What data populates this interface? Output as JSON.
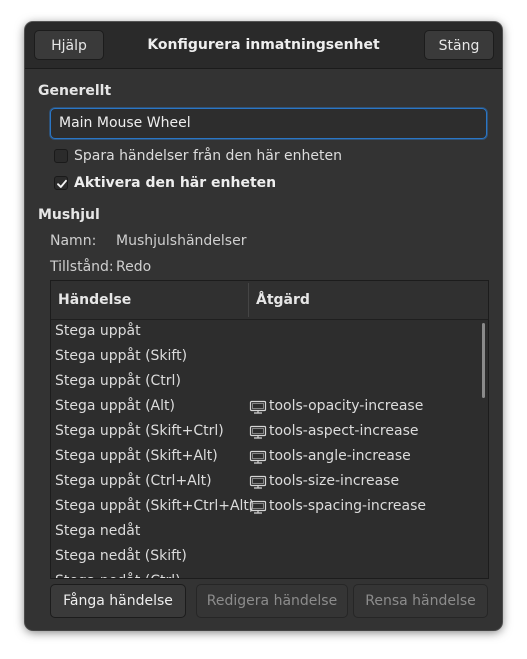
{
  "header": {
    "help_label": "Hjälp",
    "title": "Konfigurera inmatningsenhet",
    "close_label": "Stäng"
  },
  "general": {
    "section_title": "Generellt",
    "device_name": "Main Mouse Wheel",
    "save_events_label": "Spara händelser från den här enheten",
    "save_events_checked": false,
    "enable_device_label": "Aktivera den här enheten",
    "enable_device_checked": true
  },
  "mouse_wheel": {
    "section_title": "Mushjul",
    "name_label": "Namn:",
    "name_value": "Mushjulshändelser",
    "state_label": "Tillstånd:",
    "state_value": "Redo"
  },
  "table": {
    "columns": [
      "Händelse",
      "Åtgärd"
    ],
    "rows": [
      {
        "event": "Stega uppåt",
        "action": ""
      },
      {
        "event": "Stega uppåt (Skift)",
        "action": ""
      },
      {
        "event": "Stega uppåt (Ctrl)",
        "action": ""
      },
      {
        "event": "Stega uppåt (Alt)",
        "action": "tools-opacity-increase"
      },
      {
        "event": "Stega uppåt (Skift+Ctrl)",
        "action": "tools-aspect-increase"
      },
      {
        "event": "Stega uppåt (Skift+Alt)",
        "action": "tools-angle-increase"
      },
      {
        "event": "Stega uppåt (Ctrl+Alt)",
        "action": "tools-size-increase"
      },
      {
        "event": "Stega uppåt (Skift+Ctrl+Alt)",
        "action": "tools-spacing-increase"
      },
      {
        "event": "Stega nedåt",
        "action": ""
      },
      {
        "event": "Stega nedåt (Skift)",
        "action": ""
      },
      {
        "event": "Stega nedåt (Ctrl)",
        "action": ""
      }
    ]
  },
  "footer": {
    "grab_label": "Fånga händelse",
    "edit_label": "Redigera händelse",
    "clear_label": "Rensa händelse"
  },
  "icons": {
    "action": "monitor-tool-icon",
    "check": "checkmark-icon"
  },
  "colors": {
    "window_bg": "#333333",
    "focus_border": "#2a76c6"
  }
}
